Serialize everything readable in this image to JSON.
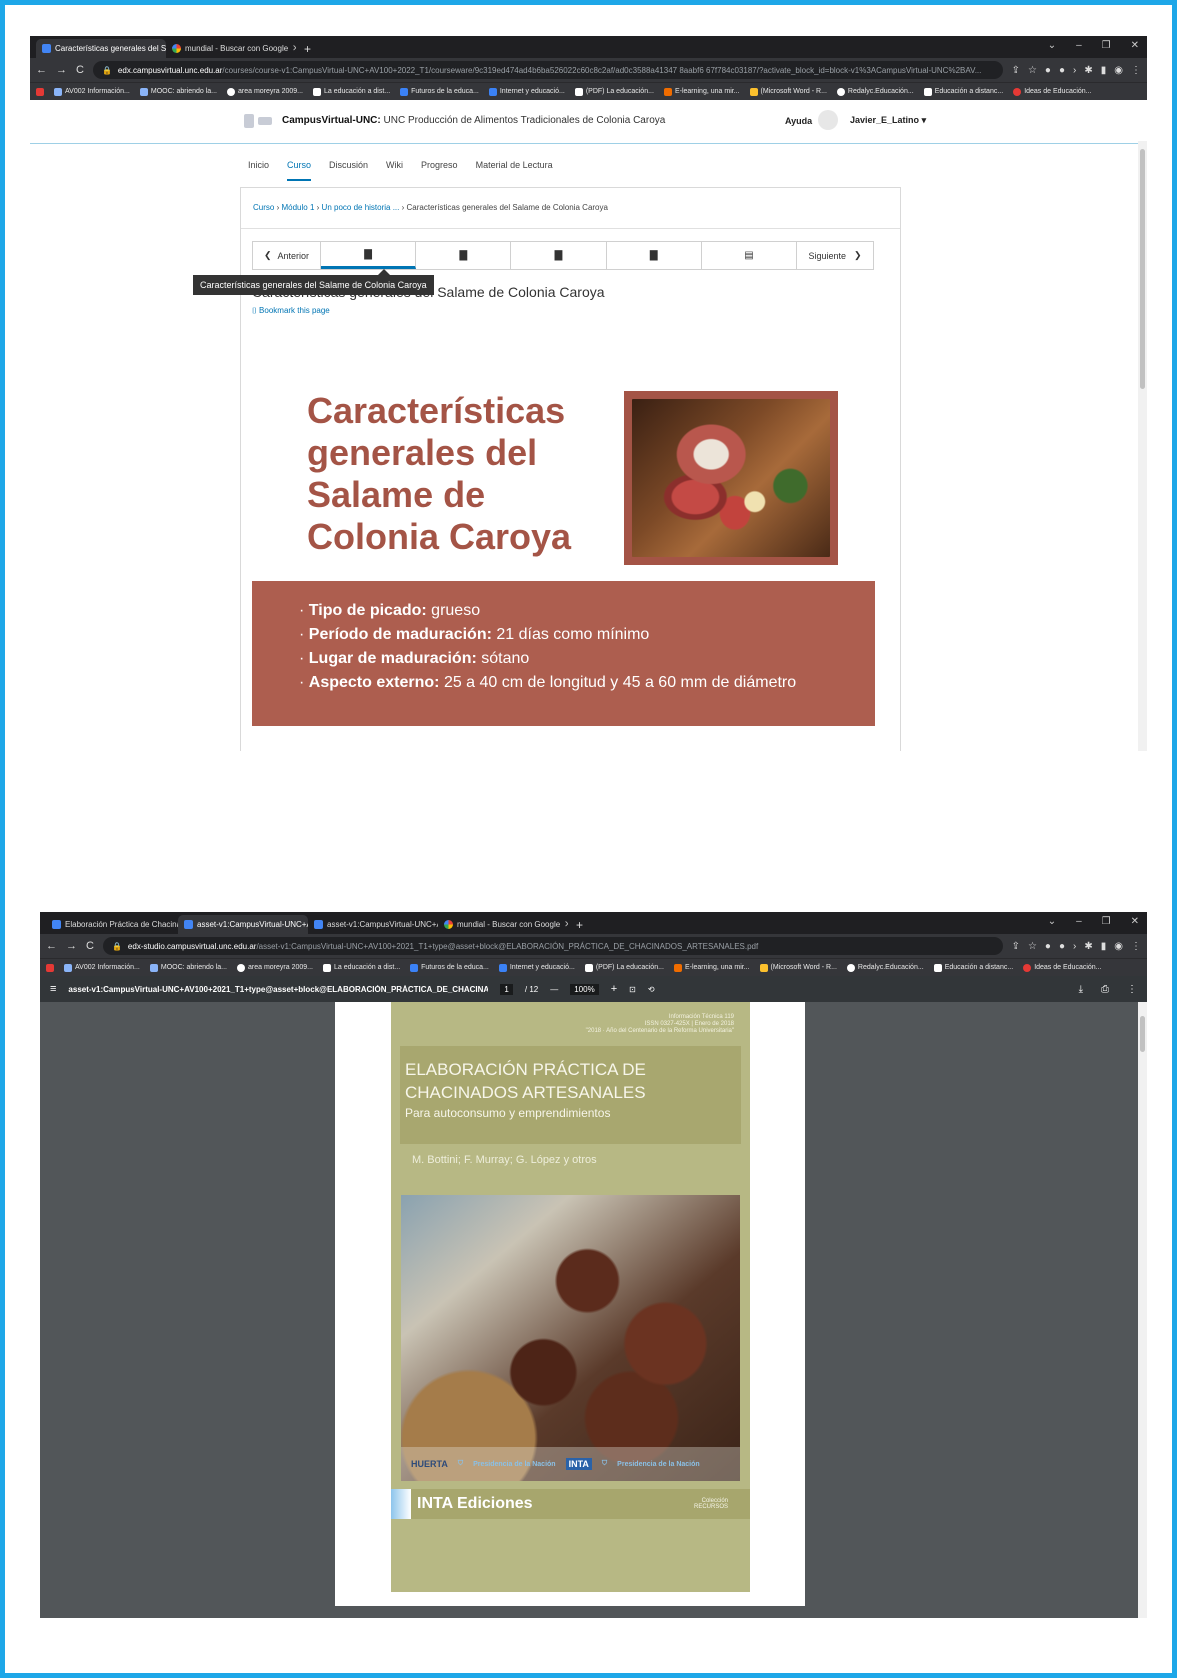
{
  "browser1": {
    "tabs": [
      {
        "label": "Características generales del Sala",
        "active": true
      },
      {
        "label": "mundial - Buscar con Google",
        "active": false
      }
    ],
    "url_domain": "edx.campusvirtual.unc.edu.ar",
    "url_path": "/courses/course-v1:CampusVirtual-UNC+AV100+2022_T1/courseware/9c319ed474ad4b6ba526022c60c8c2af/ad0c3588a41347 8aabf6 67f784c03187/?activate_block_id=block-v1%3ACampusVirtual-UNC%2BAV...",
    "bookmarks": [
      "AV002 Información...",
      "MOOC: abriendo la...",
      "area moreyra 2009...",
      "La educación a dist...",
      "Futuros de la educa...",
      "Internet y educació...",
      "(PDF) La educación...",
      "E-learning, una mir...",
      "(Microsoft Word - R...",
      "Redalyc.Educación...",
      "Educación a distanc...",
      "Ideas de Educación..."
    ]
  },
  "lms": {
    "site_name": "CampusVirtual-UNC:",
    "course_name": "UNC Producción de Alimentos Tradicionales de Colonia Caroya",
    "help": "Ayuda",
    "username": "Javier_E_Latino",
    "nav": [
      "Inicio",
      "Curso",
      "Discusión",
      "Wiki",
      "Progreso",
      "Material de Lectura"
    ],
    "breadcrumb": [
      "Curso",
      "Módulo 1",
      "Un poco de historia ...",
      "Características generales del Salame de Colonia Caroya"
    ],
    "prev": "Anterior",
    "next": "Siguiente",
    "tooltip": "Características generales del Salame de Colonia Caroya",
    "unit_title": "Características generales del Salame de Colonia Caroya",
    "bookmark": "Bookmark this page",
    "slide_title": "Características generales del Salame de Colonia Caroya",
    "facts": [
      {
        "label": "Tipo de picado:",
        "value": "grueso"
      },
      {
        "label": "Período de maduración:",
        "value": "21 días como mínimo"
      },
      {
        "label": "Lugar de maduración:",
        "value": "sótano"
      },
      {
        "label": "Aspecto externo:",
        "value": "25 a 40 cm de longitud y 45 a 60 mm de diámetro"
      }
    ]
  },
  "browser2": {
    "tabs": [
      {
        "label": "Elaboración Práctica de Chacinad",
        "active": false
      },
      {
        "label": "asset-v1:CampusVirtual-UNC+A",
        "active": true
      },
      {
        "label": "asset-v1:CampusVirtual-UNC+A",
        "active": false
      },
      {
        "label": "mundial - Buscar con Google",
        "active": false
      }
    ],
    "url_domain": "edx-studio.campusvirtual.unc.edu.ar",
    "url_path": "/asset-v1:CampusVirtual-UNC+AV100+2021_T1+type@asset+block@ELABORACIÓN_PRÁCTICA_DE_CHACINADOS_ARTESANALES.pdf",
    "pdf_filename": "asset-v1:CampusVirtual-UNC+AV100+2021_T1+type@asset+block@ELABORACIÓN_PRÁCTICA_DE_CHACINADOS...",
    "page_current": "1",
    "page_total": "/ 12",
    "zoom": "100%"
  },
  "pdf_cover": {
    "info_lines": [
      "Información Técnica 119",
      "ISSN 0327-425X | Enero de 2018",
      "\"2018 · Año del Centenario de la Reforma Universitaria\""
    ],
    "title_line1": "ELABORACIÓN PRÁCTICA DE",
    "title_line2": "CHACINADOS ARTESANALES",
    "subtitle": "Para autoconsumo y emprendimientos",
    "authors": "M. Bottini; F. Murray; G. López y otros",
    "logo_huerta": "HUERTA",
    "logo_inta": "INTA",
    "presidencia": "Presidencia de la Nación",
    "brand": "INTA Ediciones",
    "collection_label": "Colección",
    "collection": "RECURSOS"
  },
  "colors": {
    "accent": "#0075b4",
    "slide": "#a45446",
    "cover": "#b7b884"
  }
}
